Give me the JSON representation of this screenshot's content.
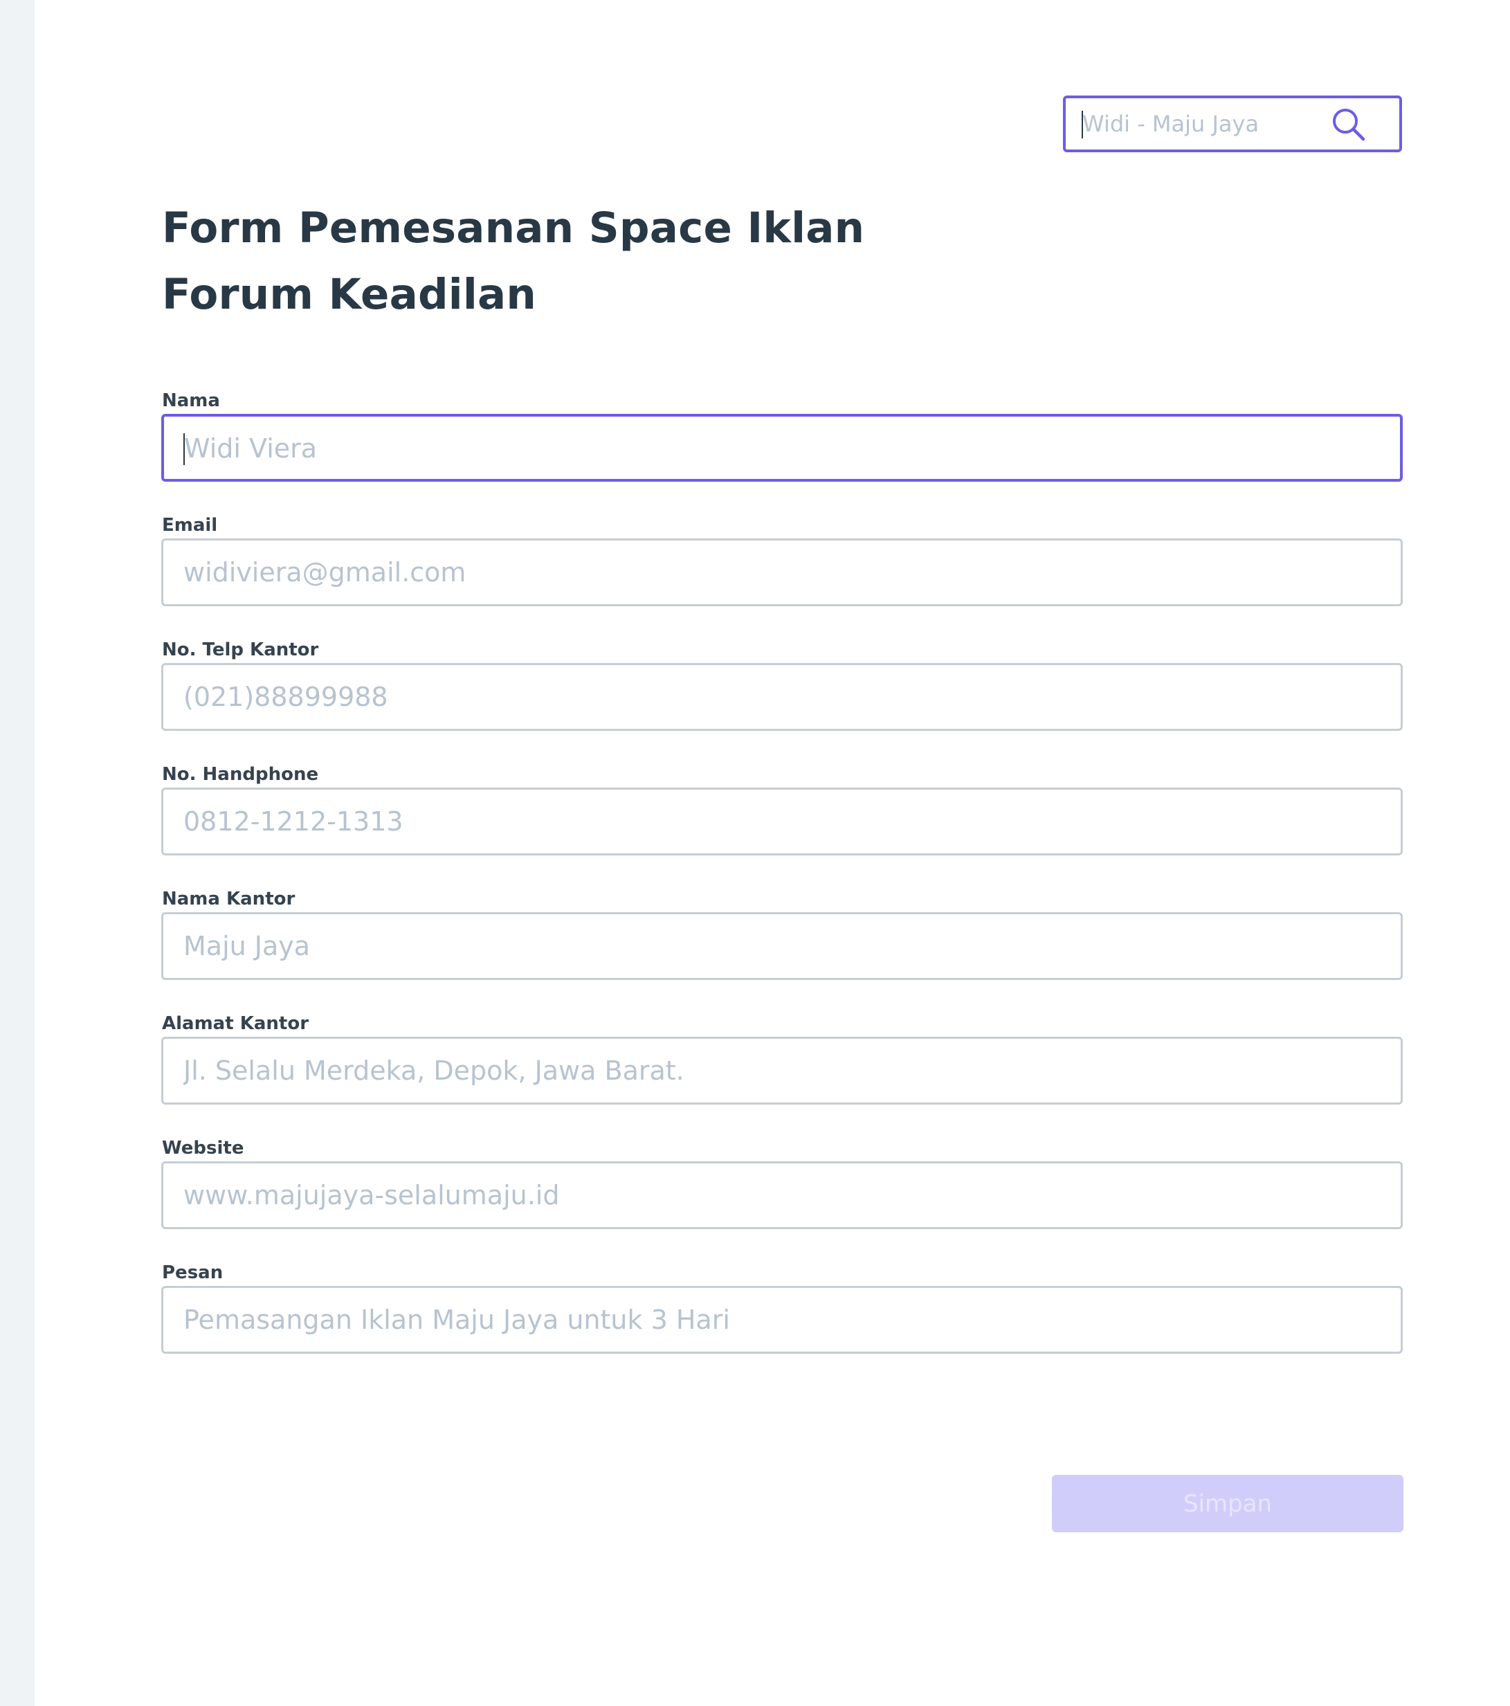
{
  "search": {
    "placeholder": "Widi - Maju Jaya",
    "icon": "search-icon",
    "accent_color": "#6c5ce7"
  },
  "form": {
    "title_line1": "Form Pemesanan Space Iklan",
    "title_line2": "Forum Keadilan",
    "fields": [
      {
        "label": "Nama",
        "placeholder": "Widi Viera"
      },
      {
        "label": "Email",
        "placeholder": "widiviera@gmail.com"
      },
      {
        "label": "No. Telp Kantor",
        "placeholder": "(021)88899988"
      },
      {
        "label": "No. Handphone",
        "placeholder": "0812-1212-1313"
      },
      {
        "label": "Nama Kantor",
        "placeholder": "Maju Jaya"
      },
      {
        "label": "Alamat Kantor",
        "placeholder": "Jl. Selalu Merdeka, Depok, Jawa Barat."
      },
      {
        "label": "Website",
        "placeholder": "www.majujaya-selalumaju.id"
      },
      {
        "label": "Pesan",
        "placeholder": "Pemasangan Iklan Maju Jaya untuk 3 Hari"
      }
    ],
    "submit_label": "Simpan"
  },
  "colors": {
    "accent": "#6c5ce7",
    "heading": "#293845",
    "placeholder": "#b7c3d0",
    "border": "#c5cdd5",
    "button_disabled_bg": "#d1cdfb",
    "sidebar_bg": "#eff3f6"
  }
}
